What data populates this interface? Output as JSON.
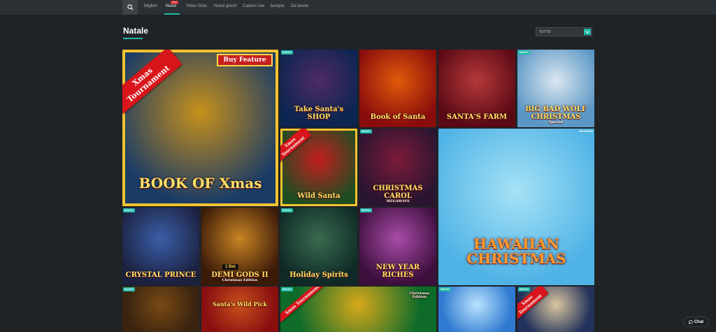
{
  "nav": {
    "items": [
      "Migliori",
      "Nuovi",
      "Video Slots",
      "Nuovi giochi",
      "Casinò Live",
      "Jackpot",
      "Da tavolo"
    ],
    "new_badge": "NEW"
  },
  "section": {
    "title": "Natale"
  },
  "filter": {
    "selected": "TUTTO"
  },
  "badge_new": "NUOVO",
  "tiles": [
    {
      "title": "BOOK OF Xmas",
      "ribbon": "Xmas Tournament",
      "buy": "Buy Feature",
      "colors": [
        "#1a3b66",
        "#c7901b"
      ]
    },
    {
      "title": "Take Santa's SHOP",
      "colors": [
        "#0c2550",
        "#4f2a66"
      ]
    },
    {
      "title": "Book of Santa",
      "colors": [
        "#8a0d0d",
        "#e05a0a"
      ]
    },
    {
      "title": "SANTA'S FARM",
      "colors": [
        "#5b0a15",
        "#b5383a"
      ]
    },
    {
      "title": "BIG BAD WOLF CHRISTMAS",
      "sub": "Special",
      "colors": [
        "#5b97c6",
        "#dbe7f0"
      ]
    },
    {
      "title": "Wild Santa",
      "ribbon": "Xmas Tournament",
      "colors": [
        "#1f4d22",
        "#c31e1e"
      ]
    },
    {
      "title": "CHRISTMAS CAROL",
      "sub": "MEGAWAYS",
      "colors": [
        "#2a1530",
        "#7b1b3a"
      ]
    },
    {
      "title": "HAWAIIAN CHRISTMAS",
      "provider": "BGAMING",
      "colors": [
        "#4fb3e6",
        "#a6e2f6"
      ]
    },
    {
      "title": "CRYSTAL PRINCE",
      "colors": [
        "#1c2140",
        "#3a5fa8"
      ]
    },
    {
      "title": "DEMI GODS II",
      "sub": "Christmas Edition",
      "logo": "1 Bet",
      "colors": [
        "#3b1a08",
        "#c98424"
      ]
    },
    {
      "title": "Holiday Spirits",
      "colors": [
        "#0f2a26",
        "#3a6b50"
      ]
    },
    {
      "title": "NEW YEAR RICHES",
      "colors": [
        "#3d0f3d",
        "#a84ca8"
      ]
    },
    {
      "title": "",
      "colors": [
        "#3a2410",
        "#7a4a14"
      ]
    },
    {
      "title": "Santa's Wild Pick",
      "colors": [
        "#8a1010",
        "#c8501b"
      ]
    },
    {
      "title": "",
      "ribbon": "Xmas Tournament",
      "sub": "Christmas Edition",
      "colors": [
        "#0e6b2a",
        "#d8a81b"
      ]
    },
    {
      "title": "",
      "colors": [
        "#2f7ad0",
        "#b9e3ff"
      ]
    },
    {
      "title": "",
      "ribbon": "Xmas Tournament",
      "colors": [
        "#23325a",
        "#d9c6a0"
      ]
    }
  ],
  "chat": {
    "label": "Chat"
  },
  "colors": {
    "accent": "#1fb8a7",
    "background": "#1f2326",
    "nav_bg": "#2b3034",
    "tournament_red": "#d8151b",
    "frame_gold": "#f2c230"
  },
  "icons": {
    "search": "search-icon",
    "chevron": "chevron-down-icon",
    "chat": "chat-bubble-icon"
  }
}
